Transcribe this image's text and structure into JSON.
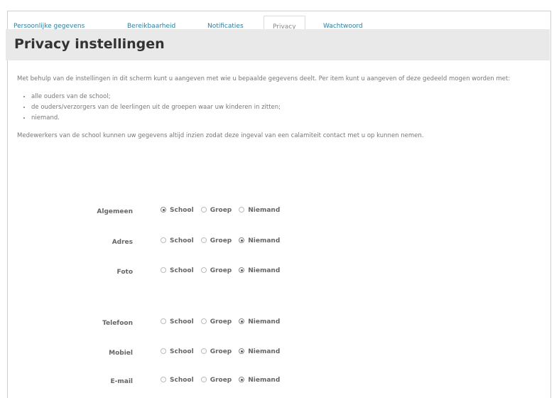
{
  "tabs": [
    {
      "label": "Persoonlijke gegevens",
      "active": false
    },
    {
      "label": "Bereikbaarheid",
      "active": false
    },
    {
      "label": "Notificaties",
      "active": false
    },
    {
      "label": "Privacy",
      "active": true
    },
    {
      "label": "Wachtwoord",
      "active": false
    }
  ],
  "page_title": "Privacy instellingen",
  "intro": "Met behulp van de instellingen in dit scherm kunt u aangeven met wie u bepaalde gegevens deelt. Per item kunt u aangeven of deze gedeeld mogen worden met:",
  "bullets": [
    "alle ouders van de school;",
    "de ouders/verzorgers van de leerlingen uit de groepen waar uw kinderen in zitten;",
    "niemand."
  ],
  "staff_note": "Medewerkers van de school kunnen uw gegevens altijd inzien zodat deze ingeval van een calamiteit contact met u op kunnen nemen.",
  "option_labels": [
    "School",
    "Groep",
    "Niemand"
  ],
  "settings": [
    {
      "label": "Algemeen",
      "selected": "School"
    },
    {
      "label": "Adres",
      "selected": "Niemand"
    },
    {
      "label": "Foto",
      "selected": "Niemand"
    },
    {
      "label": "Telefoon",
      "selected": "Niemand"
    },
    {
      "label": "Mobiel",
      "selected": "Niemand"
    },
    {
      "label": "E-mail",
      "selected": "Niemand"
    }
  ],
  "colors": {
    "tab_link": "#2e7fa0",
    "title_bar": "#e9e9e9"
  }
}
